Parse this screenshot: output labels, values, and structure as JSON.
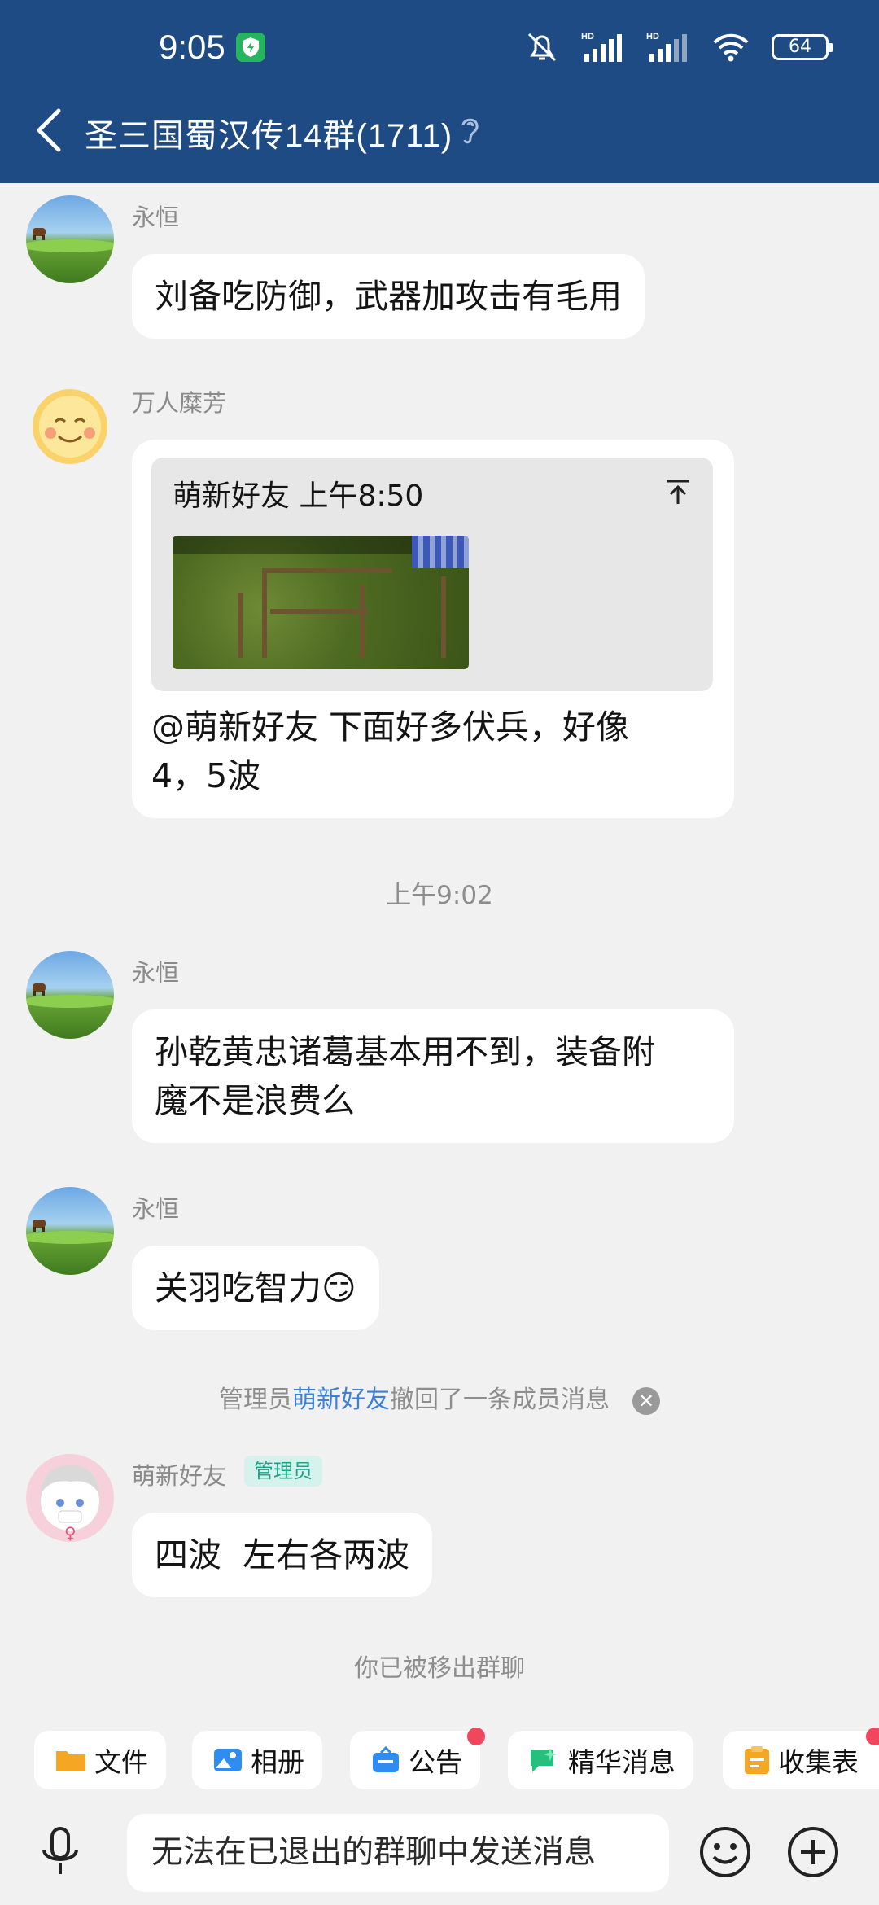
{
  "status_bar": {
    "time": "9:05",
    "battery": "64"
  },
  "header": {
    "title": "圣三国蜀汉传14群(1711)"
  },
  "messages": [
    {
      "sender": "永恒",
      "text": "刘备吃防御，武器加攻击有毛用"
    },
    {
      "sender": "万人糜芳",
      "reply_header": "萌新好友 上午8:50",
      "text_line1": "@萌新好友 下面好多伏兵，好像",
      "text_line2": "4，5波"
    },
    {
      "sender": "永恒",
      "text_line1": "孙乾黄忠诸葛基本用不到，装备附",
      "text_line2": "魔不是浪费么"
    },
    {
      "sender": "永恒",
      "text": "关羽吃智力",
      "emoji": "😏"
    },
    {
      "sender": "萌新好友",
      "badge": "管理员",
      "text": "四波  左右各两波"
    }
  ],
  "timestamp": "上午9:02",
  "system": {
    "recall_prefix": "管理员",
    "recall_name": "萌新好友",
    "recall_suffix": "撤回了一条成员消息",
    "removed": "你已被移出群聊"
  },
  "toolbar": {
    "chips": [
      {
        "label": "文件",
        "color": "#f5a623"
      },
      {
        "label": "相册",
        "color": "#2f8cf0"
      },
      {
        "label": "公告",
        "color": "#2f8cf0"
      },
      {
        "label": "精华消息",
        "color": "#25c17c"
      },
      {
        "label": "收集表",
        "color": "#f5a623"
      }
    ]
  },
  "input": {
    "placeholder": "无法在已退出的群聊中发送消息"
  },
  "colors": {
    "header": "#1f4b84",
    "link": "#3b7fd6",
    "badge_text": "#1aa588",
    "notification_dot": "#f2465c"
  }
}
